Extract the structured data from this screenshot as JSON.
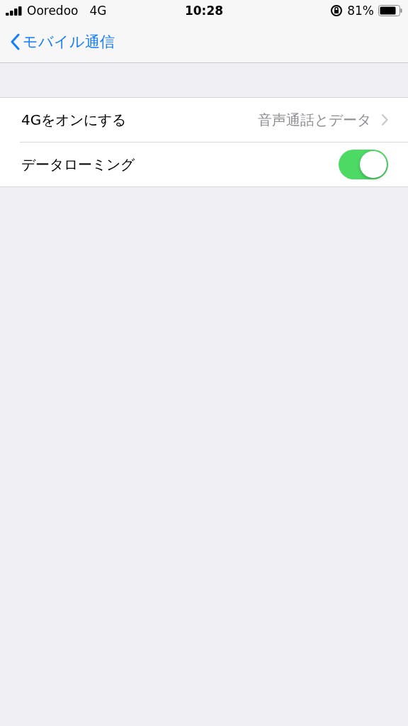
{
  "status_bar": {
    "carrier": "Ooredoo",
    "network": "4G",
    "time": "10:28",
    "battery": "81%"
  },
  "nav": {
    "back": "モバイル通信"
  },
  "rows": [
    {
      "kind": "disclosure",
      "label": "4Gをオンにする",
      "value": "音声通話とデータ"
    },
    {
      "kind": "toggle",
      "label": "データローミング",
      "on": true
    }
  ]
}
